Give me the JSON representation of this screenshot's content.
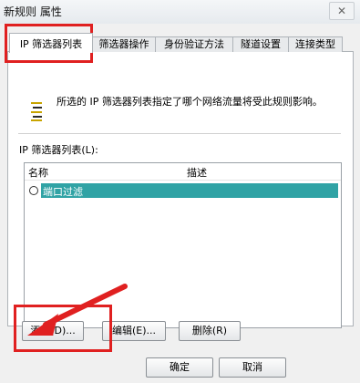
{
  "window": {
    "title": "新规则 属性",
    "close": "✕"
  },
  "tabs": [
    {
      "label": "IP 筛选器列表",
      "active": true
    },
    {
      "label": "筛选器操作"
    },
    {
      "label": "身份验证方法"
    },
    {
      "label": "隧道设置"
    },
    {
      "label": "连接类型"
    }
  ],
  "panel": {
    "description": "所选的 IP 筛选器列表指定了哪个网络流量将受此规则影响。",
    "list_label": "IP 筛选器列表(L):",
    "columns": [
      "名称",
      "描述"
    ],
    "rows": [
      {
        "name": "端口过滤",
        "description": ""
      }
    ],
    "buttons": {
      "add": "添加(D)...",
      "edit": "编辑(E)...",
      "delete": "删除(R)"
    }
  },
  "footer": {
    "ok": "确定",
    "cancel": "取消"
  },
  "colors": {
    "highlight": "#e02020",
    "selection": "#30a3a5"
  }
}
